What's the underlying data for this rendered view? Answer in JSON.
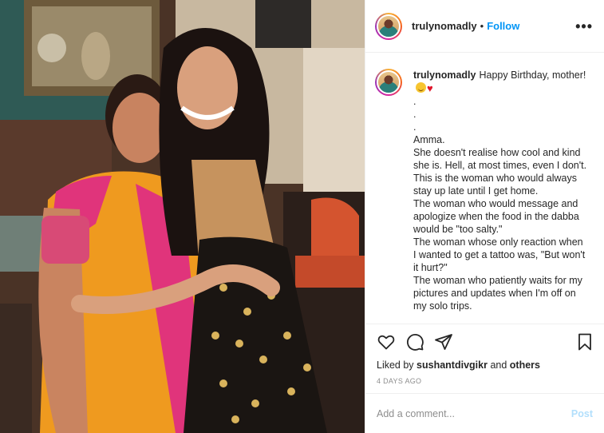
{
  "post": {
    "username": "trulynomadly",
    "follow_label": "Follow",
    "separator": "•",
    "more_label": "•••"
  },
  "caption": {
    "username": "trulynomadly",
    "first_line": "Happy Birthday, mother!",
    "emojis": [
      "smiling-face-emoji",
      "red-heart-emoji"
    ],
    "lines": [
      ".",
      ".",
      ".",
      "Amma.",
      "She doesn't realise how cool and kind she is. Hell, at most times, even I don't.",
      "This is the woman who would always stay up late until I get home.",
      "The woman who would message and apologize when the food in the dabba would be \"too salty.\"",
      "The woman whose only reaction when I wanted to get a tattoo was, \"But won't it hurt?\"",
      "The woman who patiently waits for my pictures and updates when I'm off on my solo trips."
    ]
  },
  "actions": {
    "icons": [
      "heart-icon",
      "comment-icon",
      "share-icon",
      "bookmark-icon"
    ]
  },
  "likes": {
    "prefix": "Liked by",
    "user": "sushantdivgikr",
    "joiner": "and",
    "others": "others"
  },
  "timestamp": "4 DAYS AGO",
  "comment": {
    "placeholder": "Add a comment...",
    "post_label": "Post"
  },
  "colors": {
    "accent": "#0095f6",
    "post_disabled": "#b2dffc",
    "heart_emoji": "#e0162b"
  }
}
